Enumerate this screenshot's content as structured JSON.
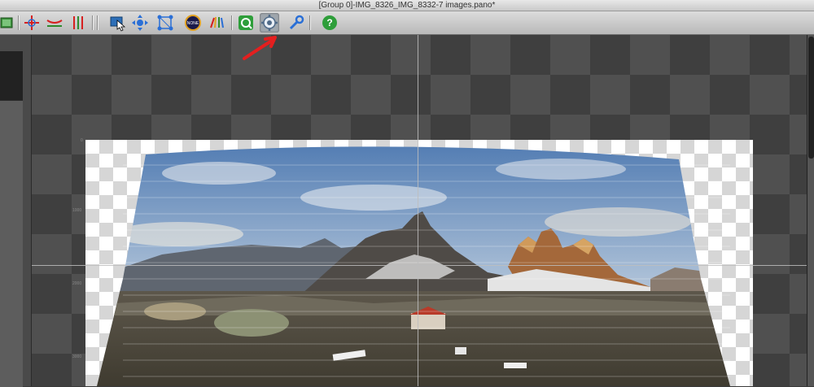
{
  "window": {
    "title": "[Group 0]-IMG_8326_IMG_8332-7 images.pano*"
  },
  "toolbar": {
    "buttons": [
      {
        "name": "preview-icon"
      },
      {
        "name": "center-icon"
      },
      {
        "name": "fit-horizon-icon"
      },
      {
        "name": "straighten-icon"
      },
      {
        "name": "select-icon"
      },
      {
        "name": "move-icon"
      },
      {
        "name": "control-points-icon"
      },
      {
        "name": "none-icon",
        "label": "NONE"
      },
      {
        "name": "color-icon"
      },
      {
        "name": "optimize-icon"
      },
      {
        "name": "settings-gear-icon",
        "active": true
      },
      {
        "name": "tools-wrench-icon"
      },
      {
        "name": "help-icon"
      }
    ]
  },
  "canvas": {
    "ruler_labels": [
      "0",
      "1000",
      "2000",
      "3000"
    ],
    "annotation": "red-arrow pointing to settings button"
  },
  "colors": {
    "accent_red": "#e41f1f",
    "panel": "#3a3a3a"
  }
}
